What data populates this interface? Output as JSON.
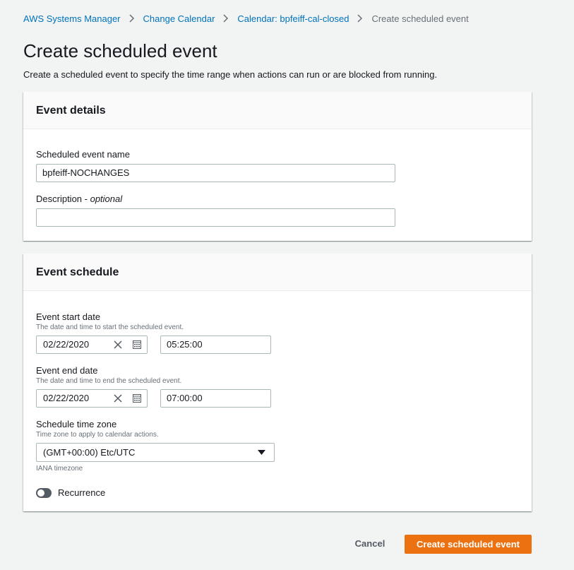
{
  "breadcrumb": [
    {
      "label": "AWS Systems Manager"
    },
    {
      "label": "Change Calendar"
    },
    {
      "label": "Calendar: bpfeiff-cal-closed"
    },
    {
      "label": "Create scheduled event"
    }
  ],
  "page": {
    "title": "Create scheduled event",
    "description": "Create a scheduled event to specify the time range when actions can run or are blocked from running."
  },
  "event_details": {
    "header": "Event details",
    "name_label": "Scheduled event name",
    "name_value": "bpfeiff-NOCHANGES",
    "description_label": "Description",
    "description_optional": "optional",
    "description_value": ""
  },
  "event_schedule": {
    "header": "Event schedule",
    "start_label": "Event start date",
    "start_hint": "The date and time to start the scheduled event.",
    "start_date": "02/22/2020",
    "start_time": "05:25:00",
    "end_label": "Event end date",
    "end_hint": "The date and time to end the scheduled event.",
    "end_date": "02/22/2020",
    "end_time": "07:00:00",
    "tz_label": "Schedule time zone",
    "tz_hint": "Time zone to apply to calendar actions.",
    "tz_value": "(GMT+00:00) Etc/UTC",
    "tz_footer": "IANA timezone",
    "recurrence_label": "Recurrence",
    "recurrence_enabled": false
  },
  "actions": {
    "cancel_label": "Cancel",
    "create_label": "Create scheduled event"
  },
  "colors": {
    "link": "#0073bb",
    "primary": "#ec7211",
    "background": "#f2f3f3"
  }
}
